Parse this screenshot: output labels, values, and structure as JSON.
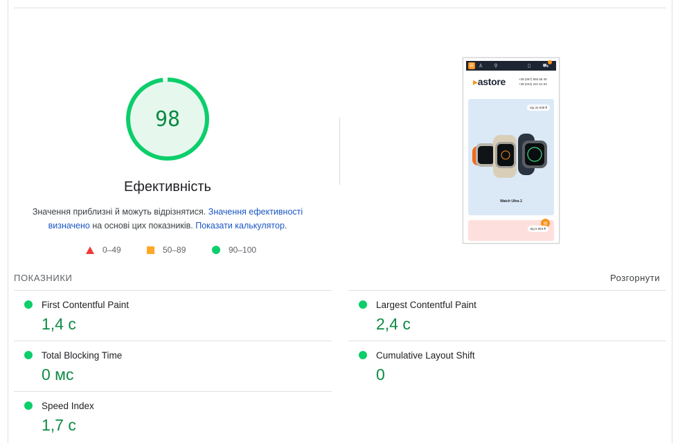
{
  "performance": {
    "score": "98",
    "score_value": 0.98,
    "title": "Ефективність",
    "description": {
      "text_1": "Значення приблизні й можуть відрізнятися. ",
      "link_1": "Значення ефективності визначено",
      "text_2": " на основі цих показників. ",
      "link_2": "Показати калькулятор",
      "text_3": "."
    },
    "legend": [
      {
        "range": "0–49",
        "icon": "red-triangle-icon",
        "color": "#ec3d3d"
      },
      {
        "range": "50–89",
        "icon": "orange-square-icon",
        "color": "#ffa726"
      },
      {
        "range": "90–100",
        "icon": "green-circle-icon",
        "color": "#0cce6b"
      }
    ],
    "colors": {
      "pass": "#0cce6b",
      "pass_text": "#0d8a44",
      "gauge_bg": "#e6f8ee",
      "link": "#1a55c4"
    }
  },
  "screenshot": {
    "logo": "astore",
    "phones": [
      "+38 (067) 855 55 45",
      "+38 (044) 221 51 63"
    ],
    "hero_price": "від 34 839 ₴",
    "hero_caption": "Watch Ultra 2",
    "promo_price": "від 5 953 ₴"
  },
  "metrics": {
    "header": "ПОКАЗНИКИ",
    "expand_label": "Розгорнути",
    "items": [
      {
        "label": "First Contentful Paint",
        "value": "1,4 с"
      },
      {
        "label": "Largest Contentful Paint",
        "value": "2,4 с"
      },
      {
        "label": "Total Blocking Time",
        "value": "0 мс"
      },
      {
        "label": "Cumulative Layout Shift",
        "value": "0"
      },
      {
        "label": "Speed Index",
        "value": "1,7 с"
      }
    ]
  }
}
